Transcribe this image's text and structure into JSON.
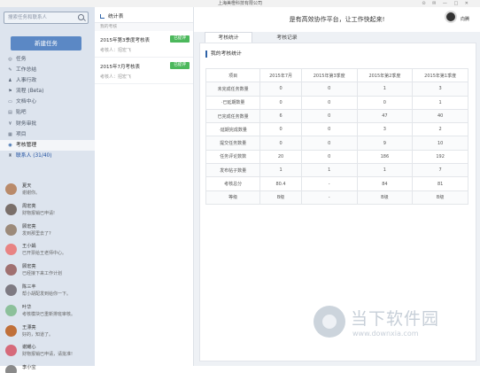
{
  "window": {
    "title": "上海美橙科技有限公司",
    "controls": "⊙ ✉ — □ ✕"
  },
  "sidebar": {
    "search_placeholder": "搜索任务和联系人",
    "new_task_label": "新建任务",
    "nav": [
      {
        "icon": "target-icon",
        "glyph": "◎",
        "label": "任务"
      },
      {
        "icon": "edit-icon",
        "glyph": "✎",
        "label": "工作总结"
      },
      {
        "icon": "user-icon",
        "glyph": "♟",
        "label": "人事行政"
      },
      {
        "icon": "flag-icon",
        "glyph": "⚑",
        "label": "流程 (Beta)"
      },
      {
        "icon": "folder-icon",
        "glyph": "▭",
        "label": "文档中心"
      },
      {
        "icon": "bulletin-icon",
        "glyph": "▤",
        "label": "贴吧"
      },
      {
        "icon": "money-icon",
        "glyph": "¥",
        "label": "财务审批"
      },
      {
        "icon": "project-icon",
        "glyph": "▦",
        "label": "项目"
      },
      {
        "icon": "assessment-icon",
        "glyph": "◉",
        "label": "考核管理"
      },
      {
        "icon": "contacts-icon",
        "glyph": "♜",
        "label": "联系人 (31/40)"
      }
    ],
    "contacts": [
      {
        "name": "夏天",
        "msg": "谢谢你。",
        "color": "#b98a6a"
      },
      {
        "name": "周宏亮",
        "msg": "财物报销已申请!",
        "color": "#7a6f6a"
      },
      {
        "name": "顾宏亮",
        "msg": "发到那里去了?",
        "color": "#9c8a7a"
      },
      {
        "name": "王小娟",
        "msg": "已开票给王老师中心。",
        "color": "#e88383"
      },
      {
        "name": "顾宏亮",
        "msg": "已经接下来工作计划",
        "color": "#a07070"
      },
      {
        "name": "陈三丰",
        "msg": "帮小胡配发到给你一下。",
        "color": "#7e7a82"
      },
      {
        "name": "叶华",
        "msg": "考核模块已重新排班审核。",
        "color": "#8cc09a"
      },
      {
        "name": "王漂亮",
        "msg": "好的，知道了。",
        "color": "#c0703a"
      },
      {
        "name": "谢耀心",
        "msg": "财物报销已申请，请批准!",
        "color": "#d66a7a"
      },
      {
        "name": "李小宝",
        "msg": "",
        "color": "#8a8a8a"
      }
    ]
  },
  "middle": {
    "title": "统计表",
    "subtitle": "我的考核",
    "items": [
      {
        "title": "2015年第3季度考核表",
        "sub": "考核人：招宏飞",
        "badge": "已提评"
      },
      {
        "title": "2015年7月考核表",
        "sub": "考核人：招宏飞",
        "badge": "已提评"
      }
    ]
  },
  "topbar": {
    "slogan": "是有高效协作平台，让工作快起来!",
    "user_name": "向腾"
  },
  "main": {
    "tabs": [
      "考核统计",
      "考核记录"
    ],
    "section_title": "我的考核统计",
    "table": {
      "headers": [
        "项目",
        "2015年7月",
        "2015年第3季度",
        "2015年第2季度",
        "2015年第1季度"
      ],
      "rows": [
        [
          "未完成任务数量",
          "0",
          "0",
          "1",
          "3"
        ],
        [
          "·已延期数量",
          "0",
          "0",
          "0",
          "1"
        ],
        [
          "已完成任务数量",
          "6",
          "0",
          "47",
          "40"
        ],
        [
          "·延期完成数量",
          "0",
          "0",
          "3",
          "2"
        ],
        [
          "提交任务数量",
          "0",
          "0",
          "9",
          "10"
        ],
        [
          "任务评论数数",
          "20",
          "0",
          "186",
          "192"
        ],
        [
          "发布帖子数量",
          "1",
          "1",
          "1",
          "7"
        ],
        [
          "考核总分",
          "80.4",
          "-",
          "84",
          "81"
        ],
        [
          "等级",
          "B级",
          "-",
          "B级",
          "B级"
        ]
      ]
    }
  },
  "watermark": {
    "text": "当下软件园",
    "url": "www.downxia.com"
  }
}
